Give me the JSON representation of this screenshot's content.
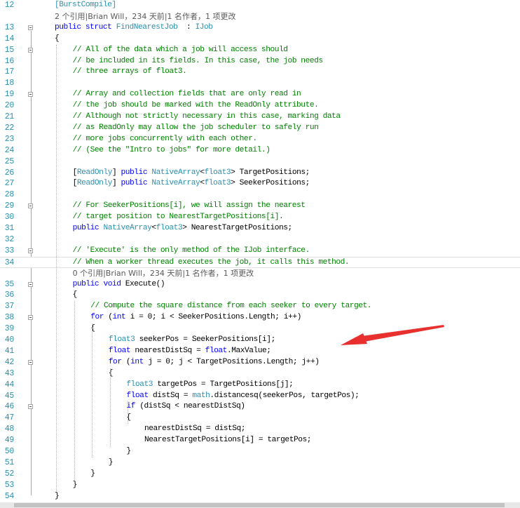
{
  "editor": {
    "lines": [
      {
        "n": "12",
        "indent": 0,
        "tokens": [
          [
            "ty",
            "[BurstCompile]"
          ]
        ]
      },
      {
        "n": "",
        "lens": true,
        "indent": 0,
        "tokens": [
          [
            "cl",
            "2 个引用|Brian Will，234 天前|1 名作者，1 项更改"
          ]
        ]
      },
      {
        "n": "13",
        "fold": true,
        "indent": 0,
        "tokens": [
          [
            "kw",
            "public "
          ],
          [
            "kw",
            "struct "
          ],
          [
            "ty",
            "FindNearestJob"
          ],
          [
            "",
            "  : "
          ],
          [
            "ty",
            "IJob"
          ]
        ]
      },
      {
        "n": "14",
        "indent": 0,
        "tokens": [
          [
            "",
            "{"
          ]
        ]
      },
      {
        "n": "15",
        "fold": true,
        "indent": 1,
        "tokens": [
          [
            "cm",
            "// All of the data which a job will access should"
          ]
        ]
      },
      {
        "n": "16",
        "indent": 1,
        "tokens": [
          [
            "cm",
            "// be included in its fields. In this case, the job needs"
          ]
        ]
      },
      {
        "n": "17",
        "indent": 1,
        "tokens": [
          [
            "cm",
            "// three arrays of float3."
          ]
        ]
      },
      {
        "n": "18",
        "indent": 1,
        "tokens": []
      },
      {
        "n": "19",
        "fold": true,
        "indent": 1,
        "tokens": [
          [
            "cm",
            "// Array and collection fields that are only read in"
          ]
        ]
      },
      {
        "n": "20",
        "indent": 1,
        "tokens": [
          [
            "cm",
            "// the job should be marked with the ReadOnly attribute."
          ]
        ]
      },
      {
        "n": "21",
        "indent": 1,
        "tokens": [
          [
            "cm",
            "// Although not strictly necessary in this case, marking data"
          ]
        ]
      },
      {
        "n": "22",
        "indent": 1,
        "tokens": [
          [
            "cm",
            "// as ReadOnly may allow the job scheduler to safely run"
          ]
        ]
      },
      {
        "n": "23",
        "indent": 1,
        "tokens": [
          [
            "cm",
            "// more jobs concurrently with each other."
          ]
        ]
      },
      {
        "n": "24",
        "indent": 1,
        "tokens": [
          [
            "cm",
            "// (See the \"Intro to jobs\" for more detail.)"
          ]
        ]
      },
      {
        "n": "25",
        "indent": 1,
        "tokens": []
      },
      {
        "n": "26",
        "indent": 1,
        "tokens": [
          [
            "",
            "["
          ],
          [
            "ty",
            "ReadOnly"
          ],
          [
            "",
            "] "
          ],
          [
            "kw",
            "public "
          ],
          [
            "ty",
            "NativeArray"
          ],
          [
            "",
            "<"
          ],
          [
            "ty",
            "float3"
          ],
          [
            "",
            "> TargetPositions;"
          ]
        ]
      },
      {
        "n": "27",
        "indent": 1,
        "tokens": [
          [
            "",
            "["
          ],
          [
            "ty",
            "ReadOnly"
          ],
          [
            "",
            "] "
          ],
          [
            "kw",
            "public "
          ],
          [
            "ty",
            "NativeArray"
          ],
          [
            "",
            "<"
          ],
          [
            "ty",
            "float3"
          ],
          [
            "",
            "> SeekerPositions;"
          ]
        ]
      },
      {
        "n": "28",
        "indent": 1,
        "tokens": []
      },
      {
        "n": "29",
        "fold": true,
        "indent": 1,
        "tokens": [
          [
            "cm",
            "// For SeekerPositions[i], we will assign the nearest"
          ]
        ]
      },
      {
        "n": "30",
        "indent": 1,
        "tokens": [
          [
            "cm",
            "// target position to NearestTargetPositions[i]."
          ]
        ]
      },
      {
        "n": "31",
        "indent": 1,
        "tokens": [
          [
            "kw",
            "public "
          ],
          [
            "ty",
            "NativeArray"
          ],
          [
            "",
            "<"
          ],
          [
            "ty",
            "float3"
          ],
          [
            "",
            "> NearestTargetPositions;"
          ]
        ]
      },
      {
        "n": "32",
        "indent": 1,
        "tokens": []
      },
      {
        "n": "33",
        "fold": true,
        "indent": 1,
        "tokens": [
          [
            "cm",
            "// 'Execute' is the only method of the IJob interface."
          ]
        ]
      },
      {
        "n": "34",
        "current": true,
        "indent": 1,
        "tokens": [
          [
            "cm",
            "// When a worker thread executes the job, it calls this method."
          ]
        ]
      },
      {
        "n": "",
        "lens": true,
        "indent": 1,
        "tokens": [
          [
            "cl",
            "0 个引用|Brian Will，234 天前|1 名作者，1 项更改"
          ]
        ]
      },
      {
        "n": "35",
        "fold": true,
        "indent": 1,
        "tokens": [
          [
            "kw",
            "public "
          ],
          [
            "kw",
            "void "
          ],
          [
            "",
            "Execute()"
          ]
        ]
      },
      {
        "n": "36",
        "indent": 1,
        "tokens": [
          [
            "",
            "{"
          ]
        ]
      },
      {
        "n": "37",
        "indent": 2,
        "tokens": [
          [
            "cm",
            "// Compute the square distance from each seeker to every target."
          ]
        ]
      },
      {
        "n": "38",
        "fold": true,
        "indent": 2,
        "tokens": [
          [
            "kw",
            "for "
          ],
          [
            "",
            "("
          ],
          [
            "kw",
            "int "
          ],
          [
            "",
            "i = 0; i < SeekerPositions.Length; i++)"
          ]
        ]
      },
      {
        "n": "39",
        "indent": 2,
        "tokens": [
          [
            "",
            "{"
          ]
        ]
      },
      {
        "n": "40",
        "indent": 3,
        "tokens": [
          [
            "ty",
            "float3 "
          ],
          [
            "",
            "seekerPos = SeekerPositions[i];"
          ]
        ]
      },
      {
        "n": "41",
        "indent": 3,
        "tokens": [
          [
            "kw",
            "float "
          ],
          [
            "",
            "nearestDistSq = "
          ],
          [
            "kw",
            "float"
          ],
          [
            "",
            ".MaxValue;"
          ]
        ]
      },
      {
        "n": "42",
        "fold": true,
        "indent": 3,
        "tokens": [
          [
            "kw",
            "for "
          ],
          [
            "",
            "("
          ],
          [
            "kw",
            "int "
          ],
          [
            "",
            "j = 0; j < TargetPositions.Length; j++)"
          ]
        ]
      },
      {
        "n": "43",
        "indent": 3,
        "tokens": [
          [
            "",
            "{"
          ]
        ]
      },
      {
        "n": "44",
        "indent": 4,
        "tokens": [
          [
            "ty",
            "float3 "
          ],
          [
            "",
            "targetPos = TargetPositions[j];"
          ]
        ]
      },
      {
        "n": "45",
        "indent": 4,
        "tokens": [
          [
            "kw",
            "float "
          ],
          [
            "",
            "distSq = "
          ],
          [
            "ty",
            "math"
          ],
          [
            "",
            ".distancesq(seekerPos, targetPos);"
          ]
        ]
      },
      {
        "n": "46",
        "fold": true,
        "indent": 4,
        "tokens": [
          [
            "kw",
            "if "
          ],
          [
            "",
            "(distSq < nearestDistSq)"
          ]
        ]
      },
      {
        "n": "47",
        "indent": 4,
        "tokens": [
          [
            "",
            "{"
          ]
        ]
      },
      {
        "n": "48",
        "indent": 5,
        "tokens": [
          [
            "",
            "nearestDistSq = distSq;"
          ]
        ]
      },
      {
        "n": "49",
        "indent": 5,
        "tokens": [
          [
            "",
            "NearestTargetPositions[i] = targetPos;"
          ]
        ]
      },
      {
        "n": "50",
        "indent": 4,
        "tokens": [
          [
            "",
            "}"
          ]
        ]
      },
      {
        "n": "51",
        "indent": 3,
        "tokens": [
          [
            "",
            "}"
          ]
        ]
      },
      {
        "n": "52",
        "indent": 2,
        "tokens": [
          [
            "",
            "}"
          ]
        ]
      },
      {
        "n": "53",
        "indent": 1,
        "tokens": [
          [
            "",
            "}"
          ]
        ]
      },
      {
        "n": "54",
        "indent": 0,
        "tokens": [
          [
            "",
            "}"
          ]
        ]
      }
    ]
  },
  "annotation": {
    "shape": "arrow",
    "color": "#e8302f"
  },
  "colors": {
    "keyword": "#0000ff",
    "type": "#2b91af",
    "comment": "#008000",
    "line_number": "#2b91af",
    "codelens": "#595959"
  }
}
